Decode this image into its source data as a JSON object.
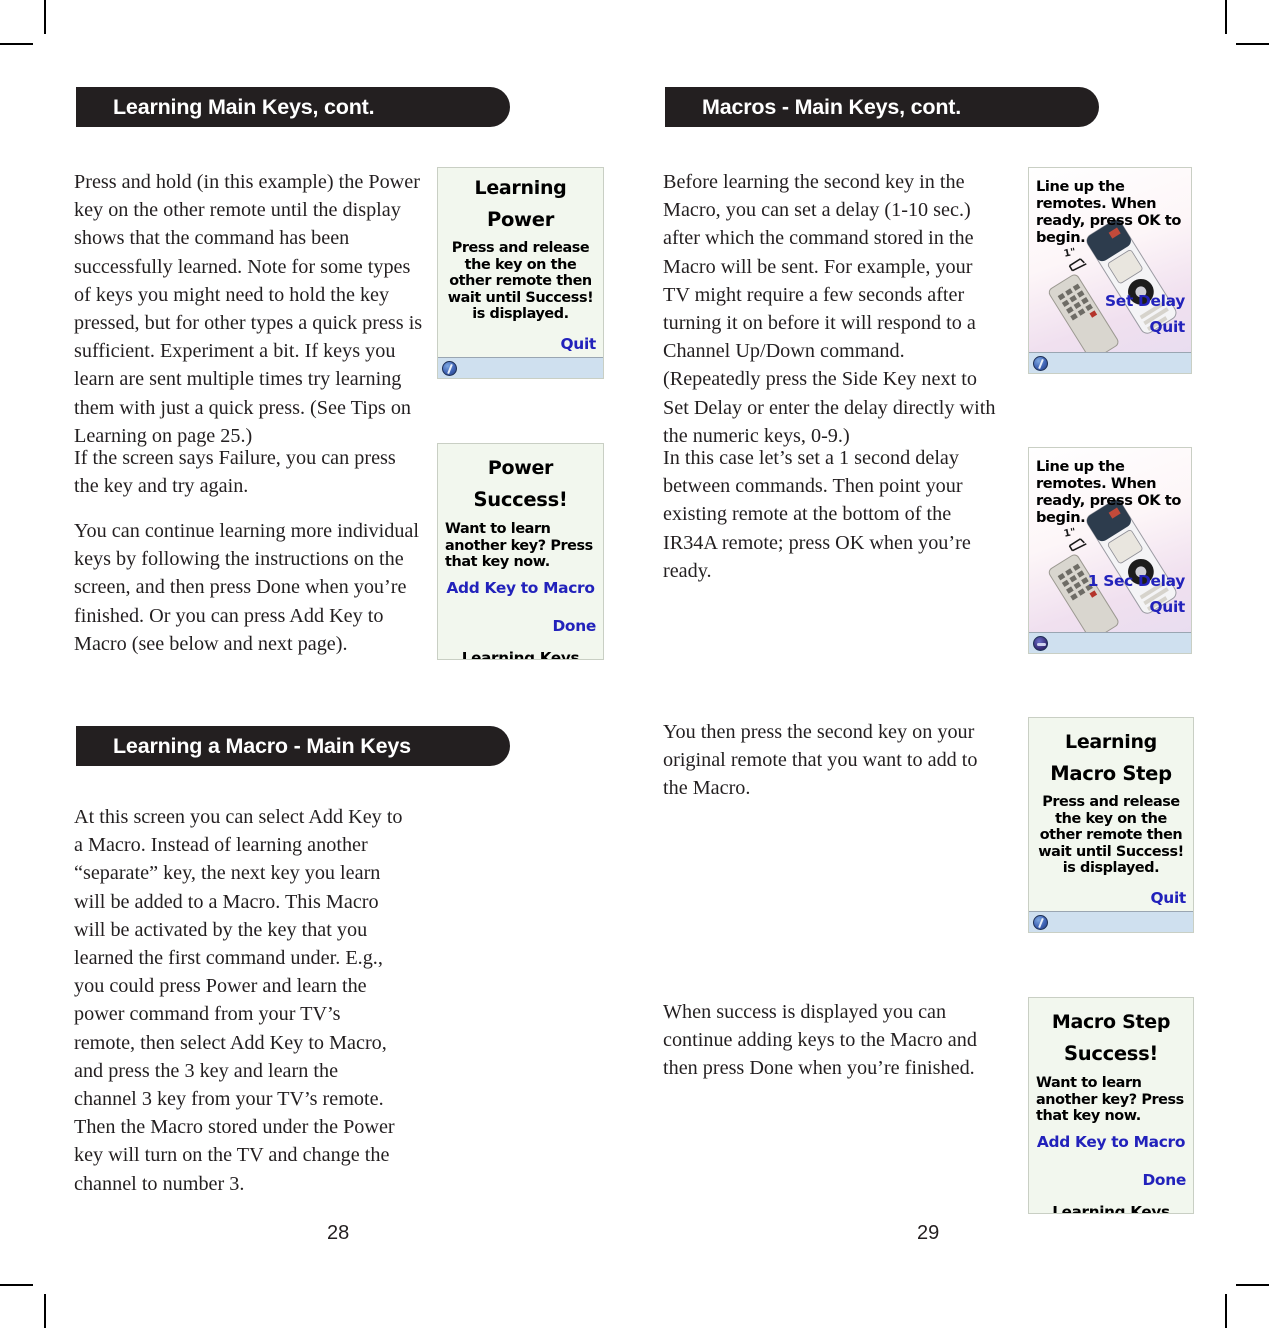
{
  "document": {
    "type": "printed-manual-spread",
    "accent_dark": "#231f20",
    "link_blue": "#2222bb",
    "lcd_background": "#f2f7ee",
    "statusbar_background": "#cfe0ef"
  },
  "left_page": {
    "page_number": "28",
    "banner_1": "Learning Main Keys, cont.",
    "banner_2": "Learning a Macro - Main Keys",
    "paragraph_1": "Press and hold (in this example) the Power key on the other remote until the display shows that the command has been successfully learned. Note for some types of keys you might need to hold the key pressed, but for other types a quick press is sufficient. Experiment a bit. If keys you learn are sent multiple times try learning them with just a quick press. (See Tips on Learning on page 25.)",
    "paragraph_2": "If the screen says Failure, you can press the key and try again.",
    "paragraph_3": "You can continue learning more individual keys by following the instructions on the screen, and then press Done when you’re finished. Or you can press Add Key to Macro (see below and next page).",
    "paragraph_4": "At this screen you can select Add Key to a Macro. Instead of learning another “separate” key, the next key you learn will be added to a Macro. This Macro will be activated by the key that you learned the first command under. E.g., you could press Power and learn the power command from your TV’s remote, then select Add Key to Macro, and press the 3 key and learn the channel 3 key from your TV’s remote. Then the Macro stored under the Power key will turn on the TV and change the channel to number 3."
  },
  "right_page": {
    "page_number": "29",
    "banner_1": "Macros - Main Keys, cont.",
    "paragraph_1": "Before learning the second key in the Macro, you can set a delay (1-10 sec.) after which the command stored in the Macro will be sent. For example, your TV might require a few seconds after turning it on before it will respond to a Channel Up/Down command. (Repeatedly press the Side Key next to Set Delay or enter the delay directly with the numeric keys, 0-9.)",
    "paragraph_2": "In this case let’s set a 1 second delay between commands. Then point your existing remote at the bottom of the IR34A remote; press OK when you’re ready.",
    "paragraph_3": "You then press the second key on your original remote that you want to add to the Macro.",
    "paragraph_4": "When success is displayed you can continue adding keys to the Macro and then press Done when you’re finished."
  },
  "screens": {
    "learning_power": {
      "title": "Learning",
      "subtitle": "Power",
      "body": "Press and release the key on the other remote then wait until Success! is displayed.",
      "quit": "Quit",
      "status_icon": "pen-icon"
    },
    "power_success": {
      "title": "Power",
      "subtitle": "Success!",
      "body": "Want to learn another key? Press that key now.",
      "add_key": "Add Key to Macro",
      "done": "Done",
      "footer": "Learning Keys"
    },
    "line_up_set_delay": {
      "body": "Line up the remotes. When ready, press OK to begin.",
      "distance_label": "1\"",
      "set_delay": "Set Delay",
      "quit": "Quit",
      "status_icon": "remote-icon"
    },
    "line_up_1sec_delay": {
      "body": "Line up the remotes. When ready, press OK to begin.",
      "distance_label": "1\"",
      "set_delay": "1 Sec Delay",
      "quit": "Quit",
      "status_icon": "disc-icon"
    },
    "learning_macro_step": {
      "title": "Learning",
      "subtitle": "Macro Step",
      "body": "Press and release the key on the other remote then wait until Success! is displayed.",
      "quit": "Quit",
      "status_icon": "pen-icon"
    },
    "macro_step_success": {
      "title": "Macro Step",
      "subtitle": "Success!",
      "body": "Want to learn another key? Press that key now.",
      "add_key": "Add Key to Macro",
      "done": "Done",
      "footer": "Learning Keys"
    }
  }
}
